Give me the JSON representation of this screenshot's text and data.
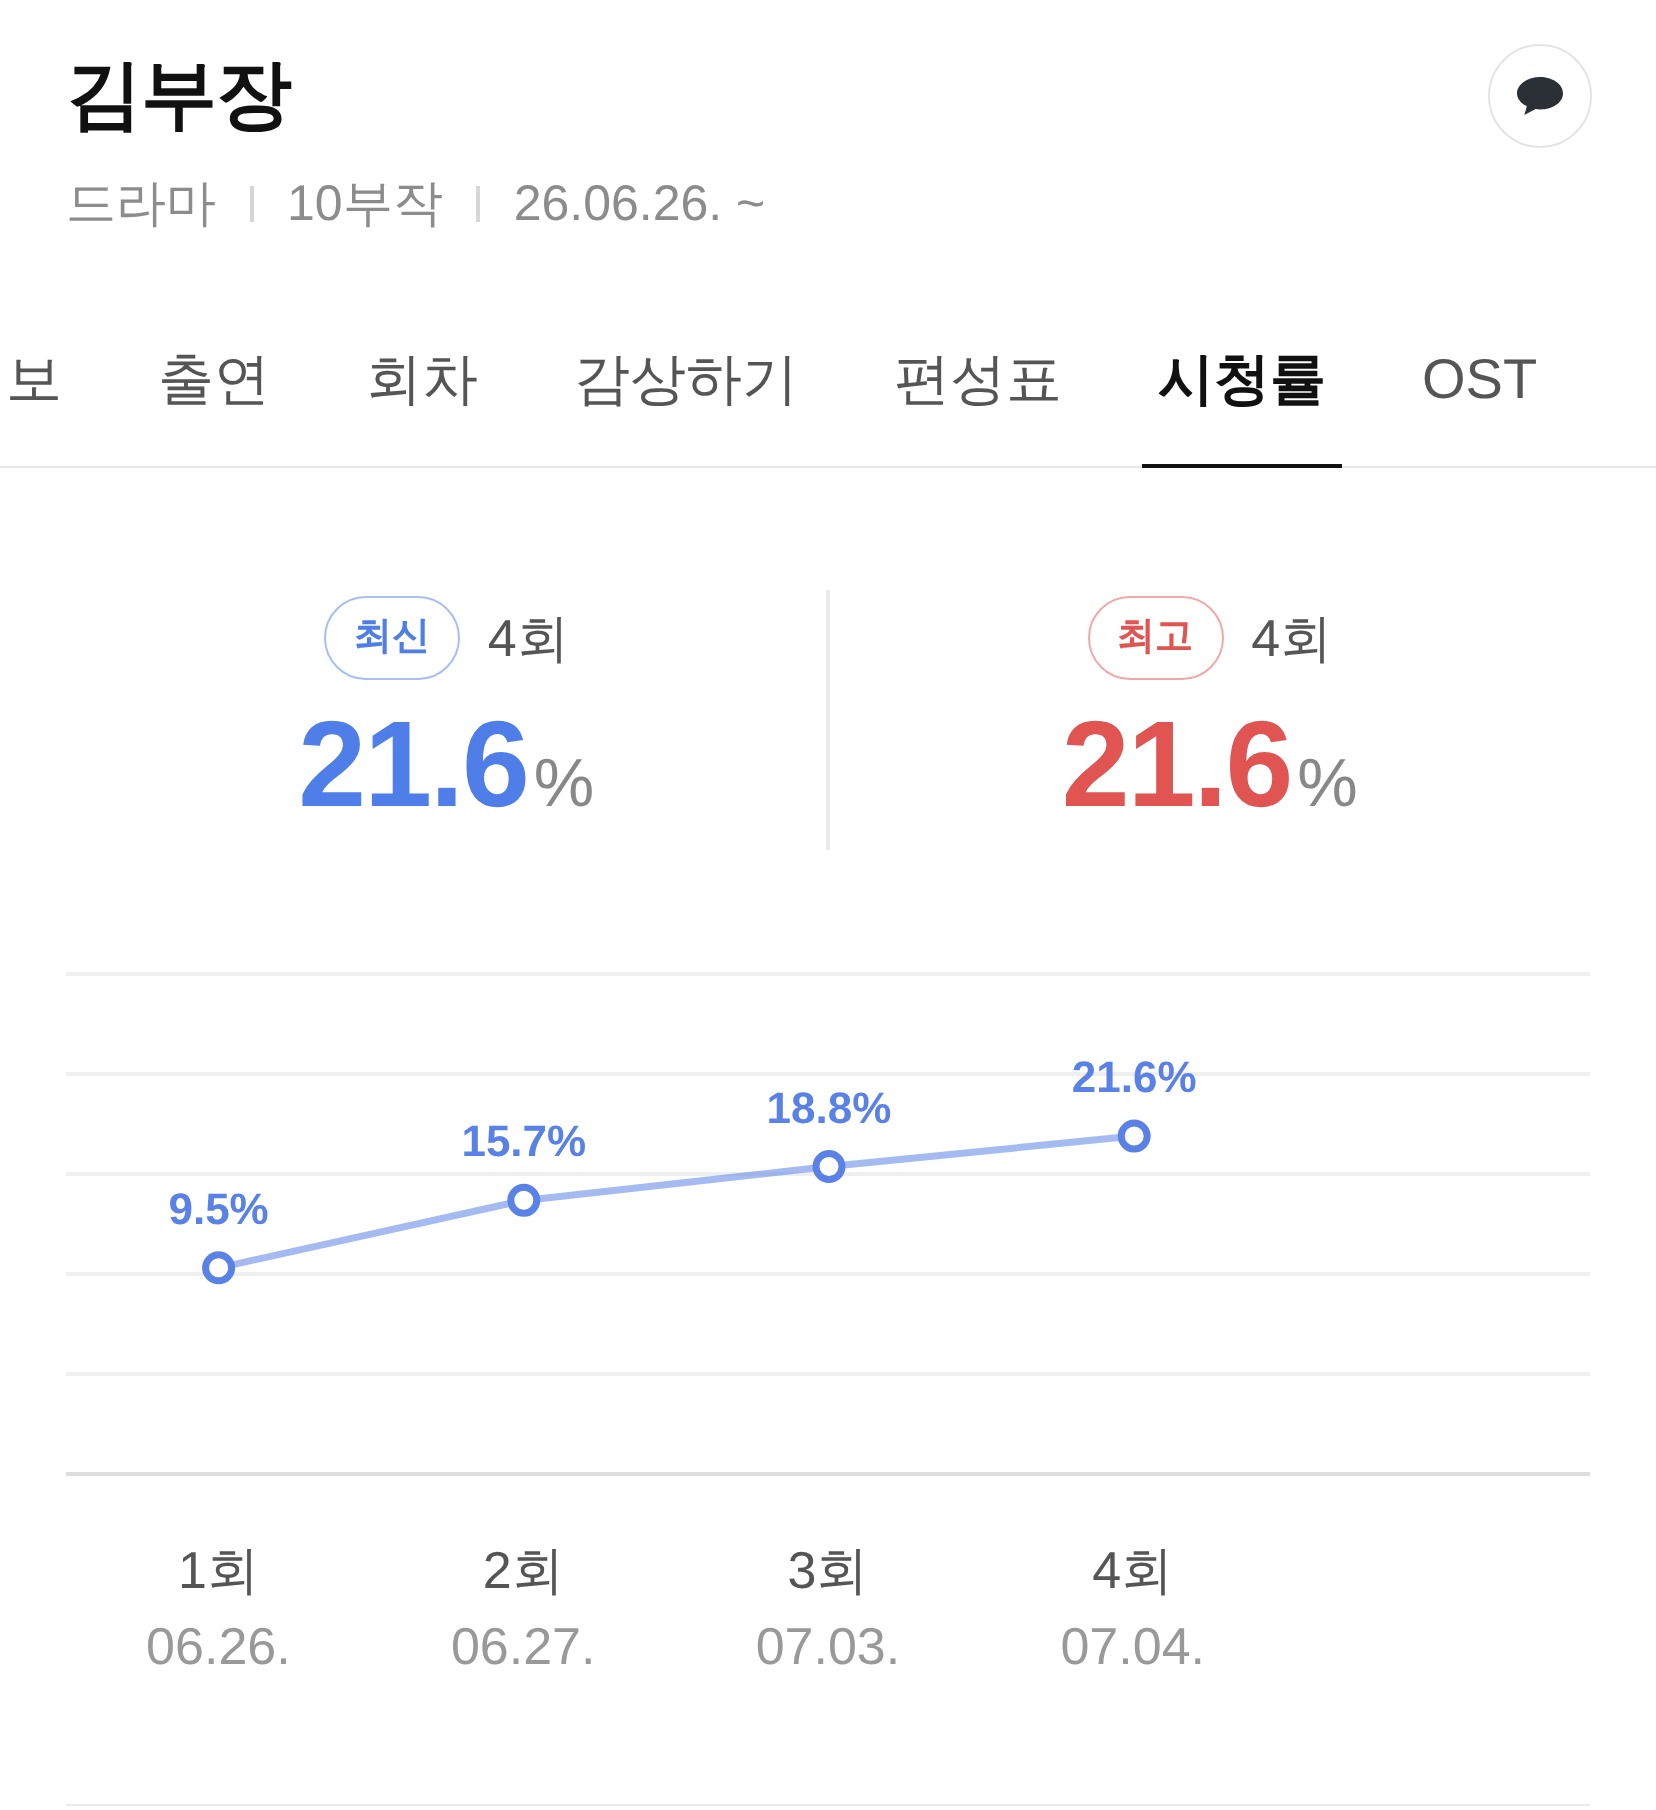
{
  "header": {
    "title": "김부장",
    "meta": [
      "드라마",
      "10부작",
      "26.06.26. ~"
    ]
  },
  "tabs": [
    {
      "label": "보",
      "selected": false
    },
    {
      "label": "출연",
      "selected": false
    },
    {
      "label": "회차",
      "selected": false
    },
    {
      "label": "감상하기",
      "selected": false
    },
    {
      "label": "편성표",
      "selected": false
    },
    {
      "label": "시청률",
      "selected": true
    },
    {
      "label": "OST",
      "selected": false
    }
  ],
  "stats": [
    {
      "badge": "최신",
      "episode": "4회",
      "value": "21.6",
      "unit": "%",
      "color": "#4f7ee8"
    },
    {
      "badge": "최고",
      "episode": "4회",
      "value": "21.6",
      "unit": "%",
      "color": "#e05552"
    }
  ],
  "chart": {
    "chart_data": {
      "type": "line",
      "categories": [
        "1회",
        "2회",
        "3회",
        "4회"
      ],
      "series": [
        {
          "color": "#5a82e6",
          "marker": true,
          "values": [
            9.5,
            15.7,
            18.8,
            21.6
          ],
          "value_labels": [
            "9.5%",
            "15.7%",
            "18.8%",
            "21.6%"
          ]
        }
      ]
    },
    "dates": [
      "06.26.",
      "06.27.",
      "07.03.",
      "07.04."
    ]
  }
}
